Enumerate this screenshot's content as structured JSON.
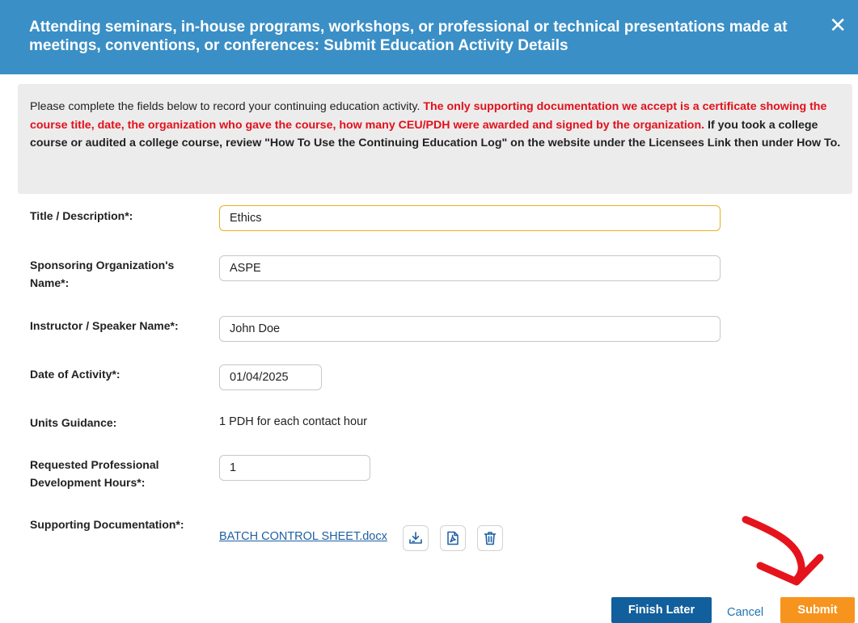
{
  "modal": {
    "title": "Attending seminars, in-house programs, workshops, or professional or technical presentations made at meetings, conventions, or conferences: Submit Education Activity Details",
    "close_icon": "close-icon",
    "colors": {
      "header": "#3a8fc6",
      "notice_bg": "#ececec",
      "warning": "#e3101a",
      "finish": "#115f9c",
      "submit": "#f7941d",
      "link": "#1f5fa3"
    }
  },
  "notice": {
    "intro": "Please complete the fields below to record your continuing education activity.",
    "warning": "The only supporting documentation we accept is a certificate showing the course title, date, the organization who gave the course, how many CEU/PDH were awarded and signed by the organization.",
    "note": "If you took a college course or audited a college course, review \"How To Use the Continuing Education Log\" on the website under the Licensees Link then under How To."
  },
  "form": {
    "title": {
      "label": "Title / Description*:",
      "value": "Ethics"
    },
    "sponsor": {
      "label": "Sponsoring Organization's Name*:",
      "value": "ASPE"
    },
    "instructor": {
      "label": "Instructor / Speaker Name*:",
      "value": "John Doe"
    },
    "date": {
      "label": "Date of Activity*:",
      "value": "01/04/2025"
    },
    "units": {
      "label": "Units Guidance:",
      "value": "1 PDH for each contact hour"
    },
    "hours": {
      "label": "Requested Professional Development Hours*:",
      "value": "1"
    },
    "documentation": {
      "label": "Supporting Documentation*:",
      "file_name": "BATCH CONTROL SHEET.docx",
      "icons": [
        "download-icon",
        "pdf-icon",
        "trash-icon"
      ]
    }
  },
  "actions": {
    "finish_later": "Finish Later",
    "cancel": "Cancel",
    "submit": "Submit"
  },
  "annotation": {
    "type": "red-hand-drawn-arrow",
    "points_to": "submit",
    "color": "#e5131c"
  }
}
